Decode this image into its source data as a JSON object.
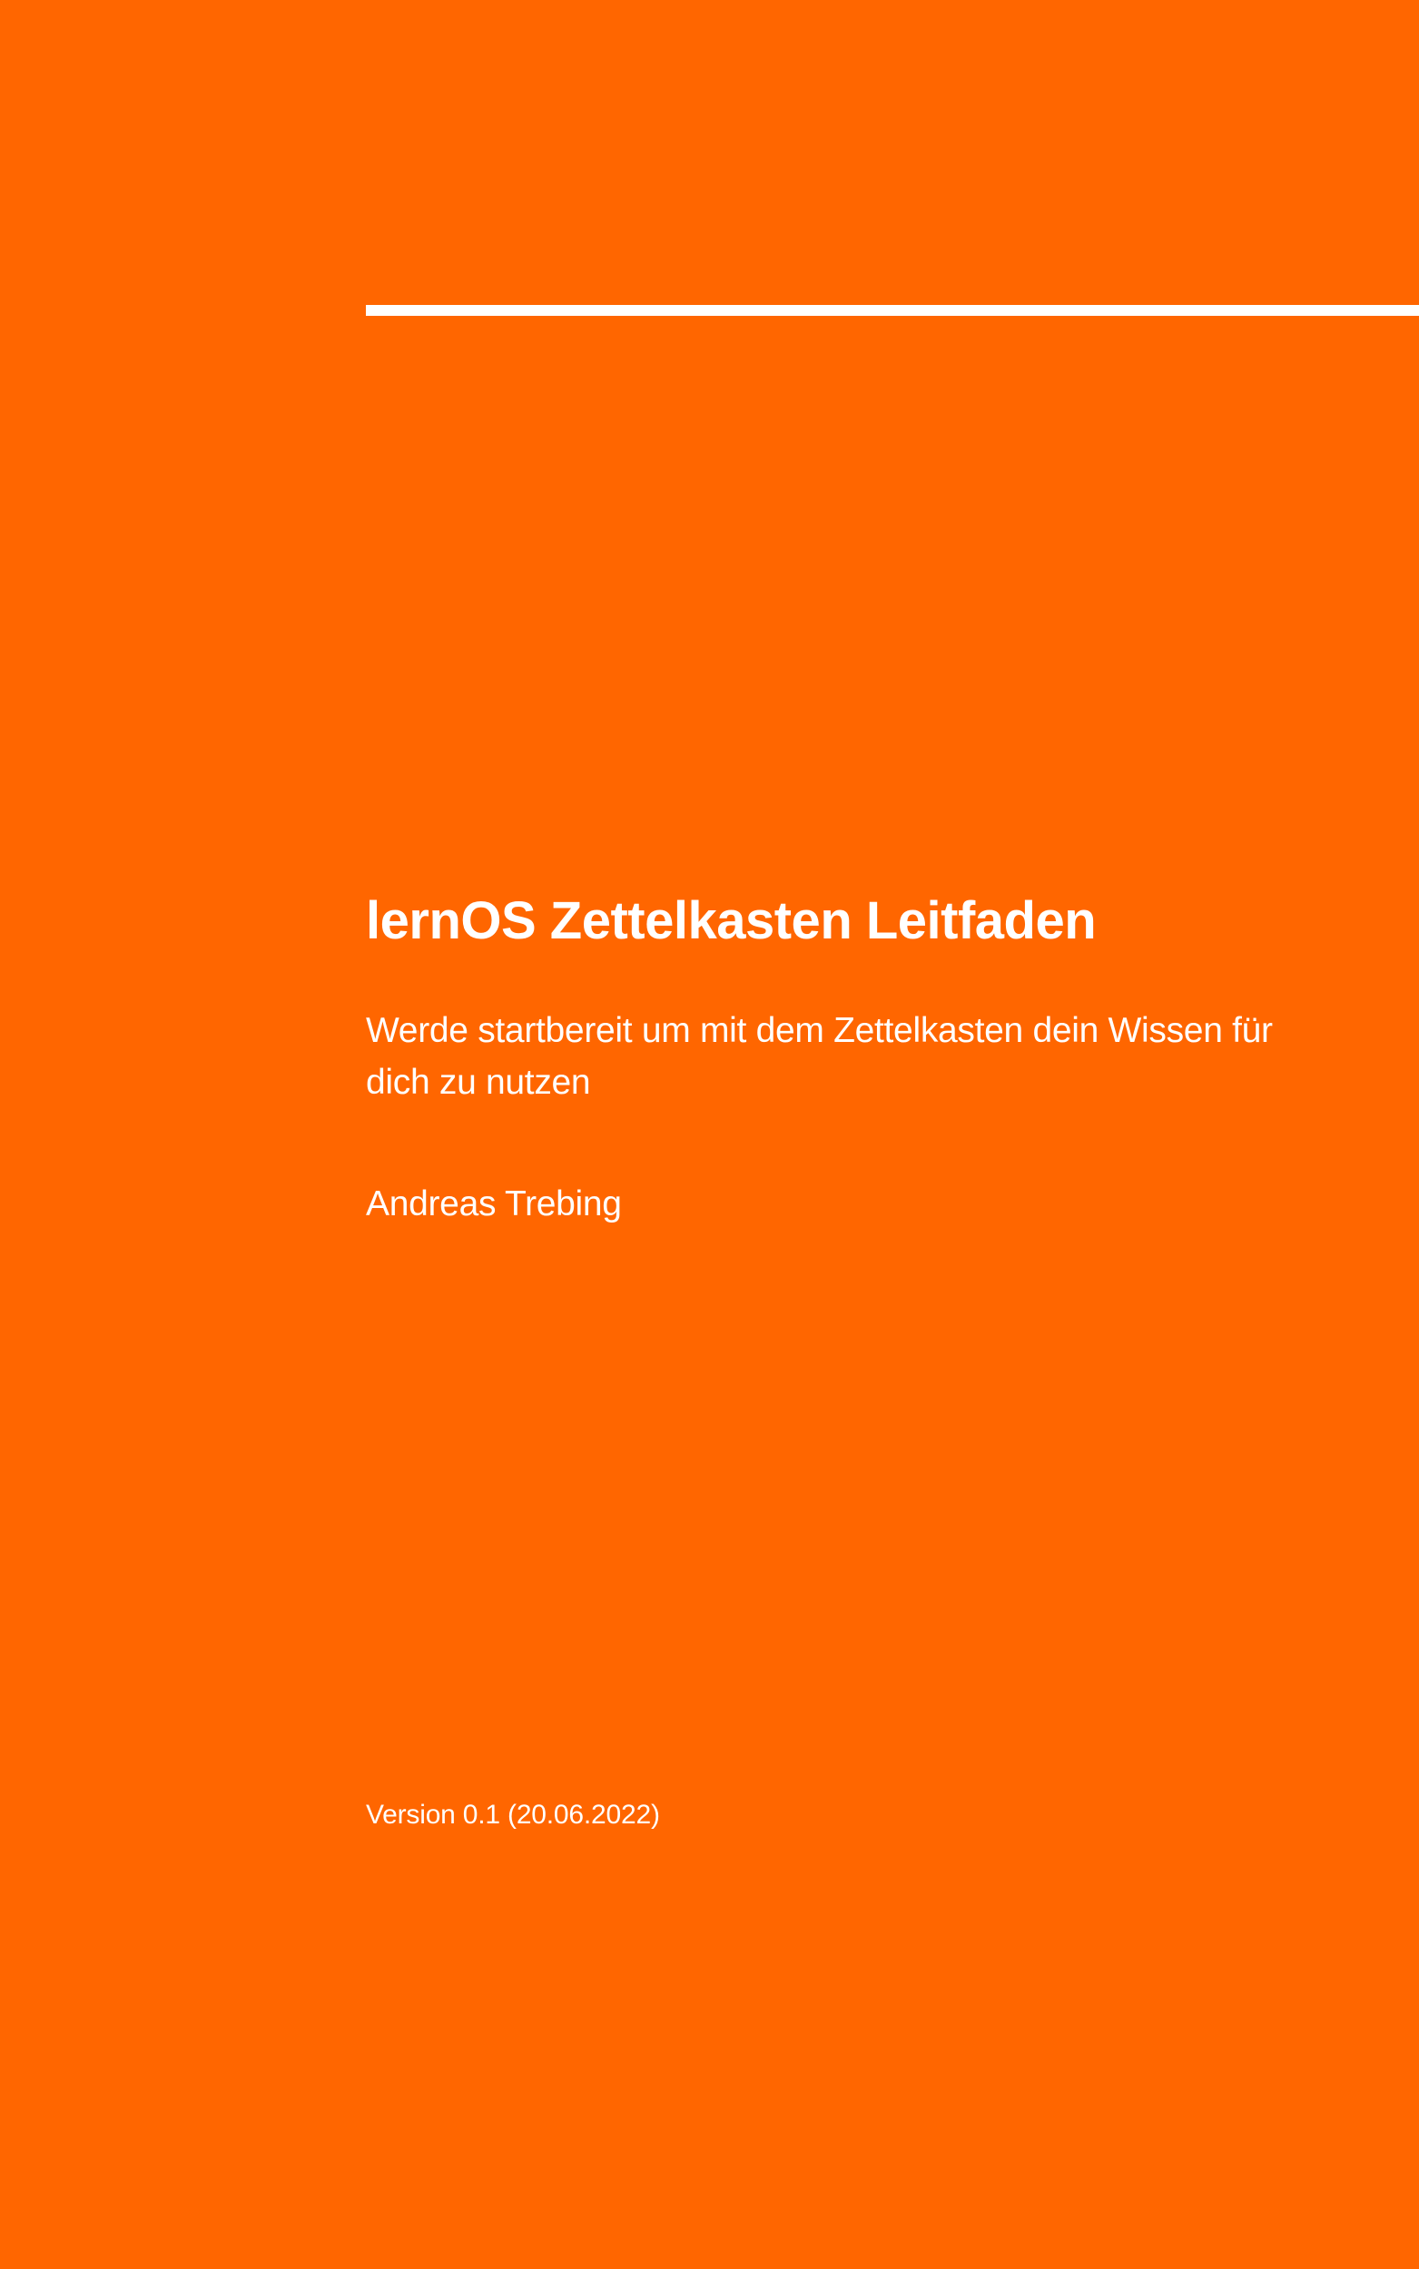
{
  "cover": {
    "title": "lernOS Zettelkasten Leitfaden",
    "subtitle": "Werde startbereit um mit dem Zettelkasten dein Wissen für dich zu nutzen",
    "author": "Andreas Trebing",
    "version": "Version 0.1 (20.06.2022)"
  },
  "colors": {
    "background": "#FF6600",
    "text": "#FFFFFF",
    "rule": "#FFFFFF"
  }
}
